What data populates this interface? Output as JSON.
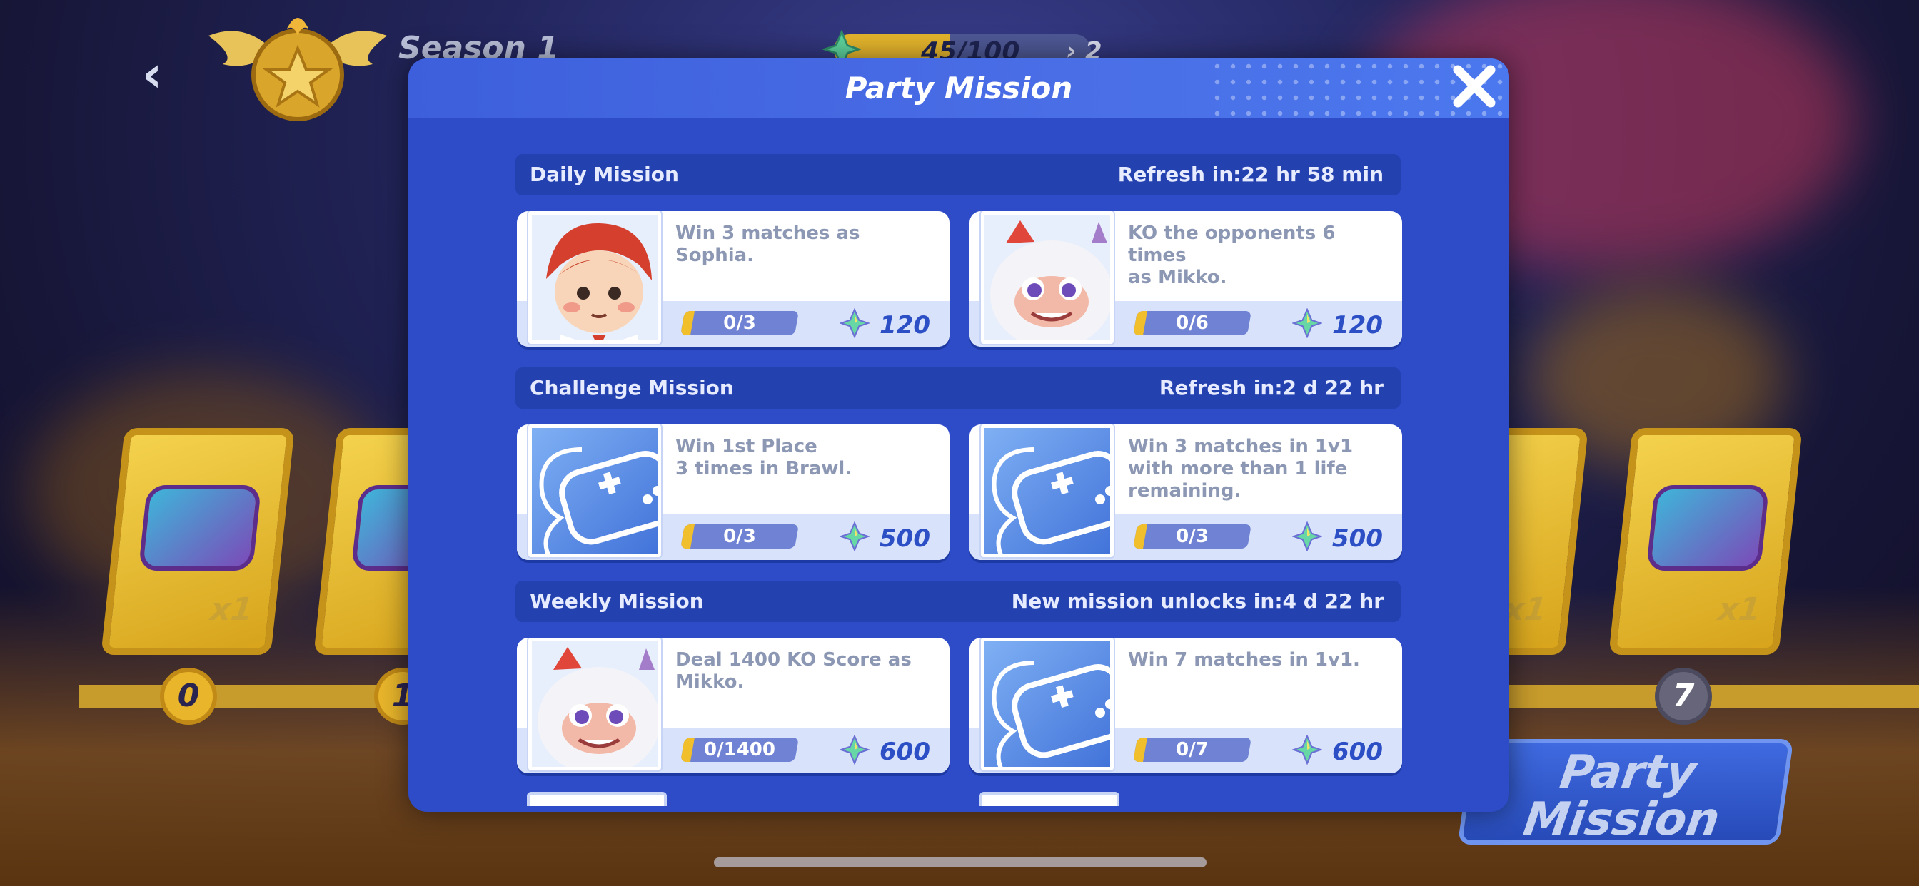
{
  "hud": {
    "season_title": "Season 1",
    "xp_text": "45/100",
    "xp_progress": 0.45,
    "level_text": "› 2"
  },
  "background": {
    "reward_qty": "x1",
    "track_nodes": [
      "0",
      "1",
      "7"
    ],
    "party_banner_line1": "Party",
    "party_banner_line2": "Mission"
  },
  "modal": {
    "title": "Party Mission",
    "sections": [
      {
        "name": "Daily Mission",
        "refresh": "Refresh in:22 hr 58 min",
        "missions": [
          {
            "desc": "Win 3 matches as Sophia.",
            "progress": "0/3",
            "reward": "120",
            "portrait": "sophia-portrait"
          },
          {
            "desc": "KO the opponents 6 times\nas Mikko.",
            "progress": "0/6",
            "reward": "120",
            "portrait": "mikko-portrait"
          }
        ]
      },
      {
        "name": "Challenge Mission",
        "refresh": "Refresh in:2 d 22 hr",
        "missions": [
          {
            "desc": "Win 1st Place\n3 times in Brawl.",
            "progress": "0/3",
            "reward": "500",
            "portrait": "controller-icon"
          },
          {
            "desc": "Win 3 matches in 1v1\nwith more than 1 life\nremaining.",
            "progress": "0/3",
            "reward": "500",
            "portrait": "controller-icon"
          }
        ]
      },
      {
        "name": "Weekly Mission",
        "refresh": "New mission unlocks in:4 d 22 hr",
        "missions": [
          {
            "desc": "Deal 1400 KO Score as\nMikko.",
            "progress": "0/1400",
            "reward": "600",
            "portrait": "mikko-portrait"
          },
          {
            "desc": "Win 7 matches in 1v1.",
            "progress": "0/7",
            "reward": "600",
            "portrait": "controller-icon"
          }
        ]
      }
    ]
  },
  "colors": {
    "modal_bg": "#2e4bc8",
    "section_bar": "#2441b0",
    "reward_text": "#2d4fc5",
    "progress_fill": "#f1be2c"
  }
}
